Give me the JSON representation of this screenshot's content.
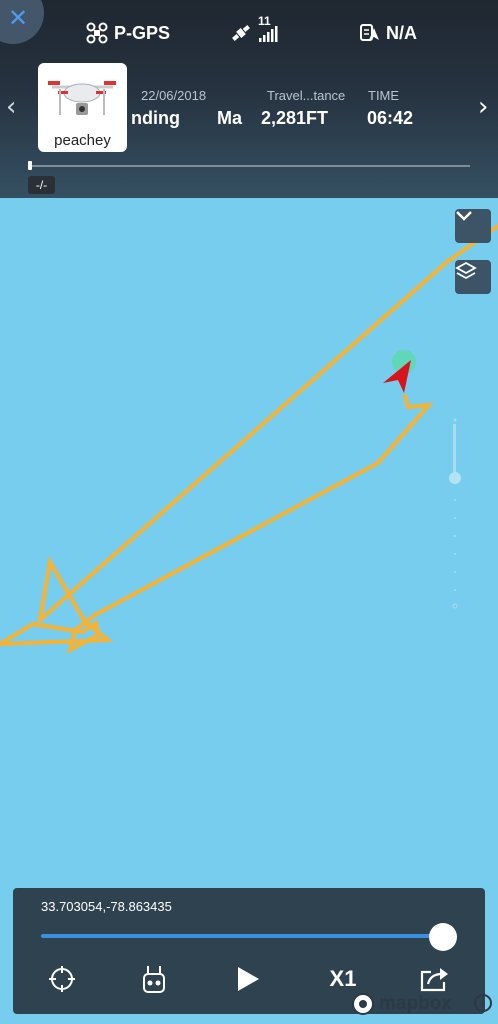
{
  "status": {
    "flight_mode": "P-GPS",
    "satellite_count": "11",
    "signal": "N/A"
  },
  "flight": {
    "aircraft_name": "peachey",
    "date": "22/06/2018",
    "title_fragment": "nding",
    "title_fragment_2": "Ma",
    "distance_label": "Travel...tance",
    "distance_value": "2,281FT",
    "time_label": "TIME",
    "time_value": "06:42",
    "timeline_chip": "-/-"
  },
  "player": {
    "coordinates": "33.703054,-78.863435",
    "progress": 1.0,
    "speed": "X1"
  },
  "map": {
    "attribution": "mapbox",
    "info": "i",
    "track_color": "#f5b335",
    "water_color": "#76cdee"
  },
  "icons": {
    "close": "close-icon",
    "drone": "drone-icon",
    "satellite": "satellite-icon",
    "signal": "signal-bars-icon",
    "remote": "remote-signal-icon",
    "prev": "chevron-left-icon",
    "next": "chevron-right-icon",
    "collapse": "chevron-down-icon",
    "layers": "layers-icon",
    "locate": "crosshair-icon",
    "controller": "controller-icon",
    "play": "play-icon",
    "share": "share-icon"
  }
}
